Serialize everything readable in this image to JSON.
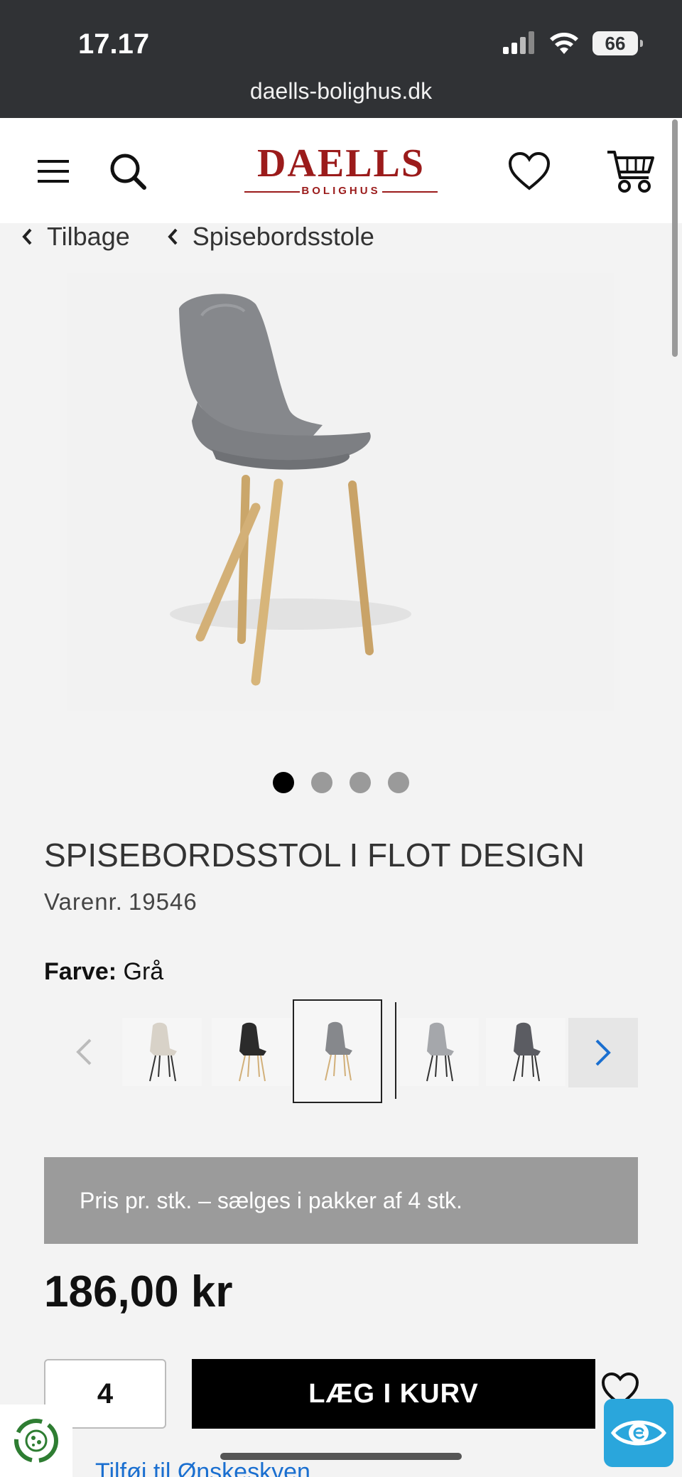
{
  "status_bar": {
    "time": "17.17",
    "battery": "66",
    "url": "daells-bolighus.dk"
  },
  "header": {
    "logo_main": "DAELLS",
    "logo_sub": "BOLIGHUS",
    "icons": [
      "menu-icon",
      "search-icon",
      "heart-icon",
      "cart-icon"
    ]
  },
  "breadcrumbs": {
    "back": "Tilbage",
    "category": "Spisebordsstole"
  },
  "gallery": {
    "count": 4,
    "active_index": 0
  },
  "product": {
    "title": "SPISEBORDSSTOL I FLOT DESIGN",
    "sku_label": "Varenr.",
    "sku": "19546",
    "color_label": "Farve:",
    "color_value": "Grå",
    "swatch_colors": [
      "#d8d2c8",
      "#2b2b2b",
      "#86888c",
      "#a5a7ab",
      "#5b5c62"
    ],
    "selected_swatch": 2,
    "pack_note": "Pris pr. stk. – sælges i pakker af 4 stk.",
    "price": "186,00 kr",
    "quantity": "4",
    "add_to_cart": "LÆG I KURV",
    "wishlist_link": "Tilføj til Ønskeskyen"
  },
  "colors": {
    "brand": "#9b1b1b",
    "link": "#1a6fd0",
    "badge": "#2aa6dc"
  }
}
